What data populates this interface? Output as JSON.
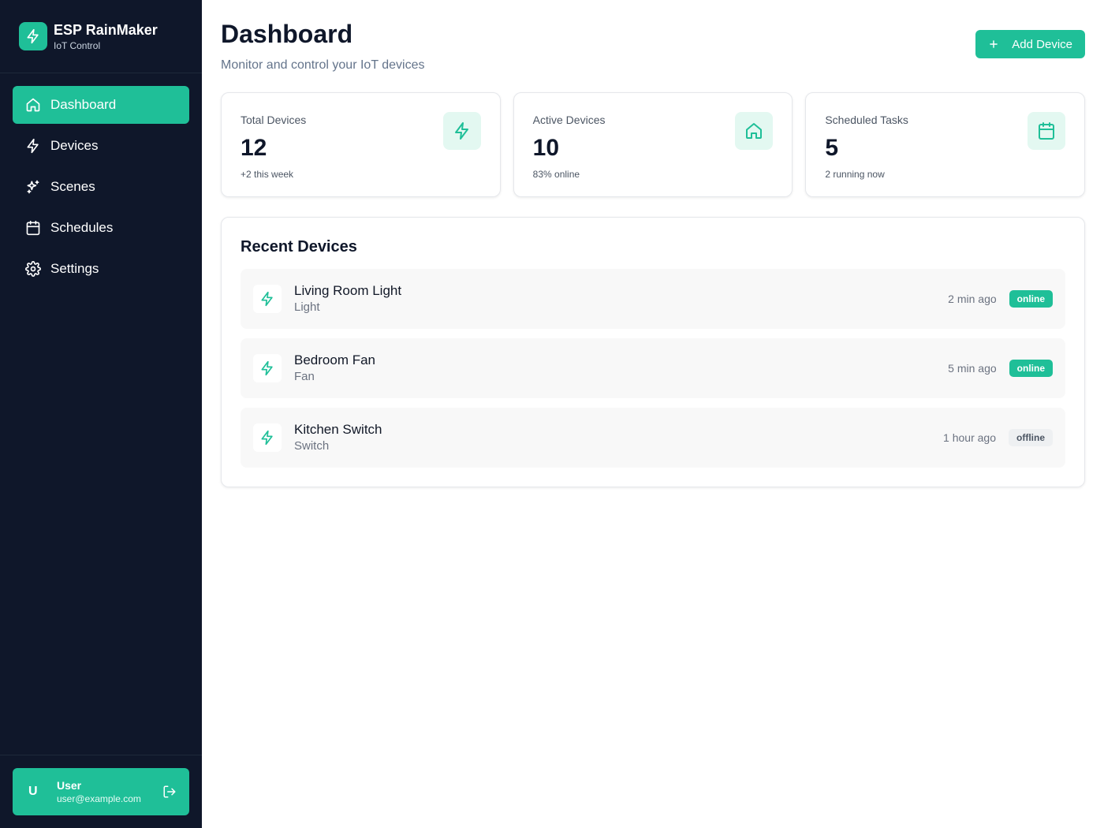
{
  "brand": {
    "title": "ESP RainMaker",
    "subtitle": "IoT Control"
  },
  "sidebar": {
    "items": [
      {
        "label": "Dashboard",
        "icon": "home-icon",
        "active": true
      },
      {
        "label": "Devices",
        "icon": "zap-icon",
        "active": false
      },
      {
        "label": "Scenes",
        "icon": "sparkles-icon",
        "active": false
      },
      {
        "label": "Schedules",
        "icon": "calendar-icon",
        "active": false
      },
      {
        "label": "Settings",
        "icon": "gear-icon",
        "active": false
      }
    ]
  },
  "user": {
    "initial": "U",
    "name": "User",
    "email": "user@example.com"
  },
  "header": {
    "title": "Dashboard",
    "subtitle": "Monitor and control your IoT devices",
    "add_button": "Add Device"
  },
  "stats": [
    {
      "label": "Total Devices",
      "value": "12",
      "note": "+2 this week",
      "icon": "zap-icon"
    },
    {
      "label": "Active Devices",
      "value": "10",
      "note": "83% online",
      "icon": "home-icon"
    },
    {
      "label": "Scheduled Tasks",
      "value": "5",
      "note": "2 running now",
      "icon": "calendar-icon"
    }
  ],
  "recent": {
    "title": "Recent Devices",
    "devices": [
      {
        "name": "Living Room Light",
        "type": "Light",
        "time": "2 min ago",
        "status": "online"
      },
      {
        "name": "Bedroom Fan",
        "type": "Fan",
        "time": "5 min ago",
        "status": "online"
      },
      {
        "name": "Kitchen Switch",
        "type": "Switch",
        "time": "1 hour ago",
        "status": "offline"
      }
    ]
  },
  "colors": {
    "accent": "#1fbf98",
    "sidebar_bg": "#0f172a"
  }
}
